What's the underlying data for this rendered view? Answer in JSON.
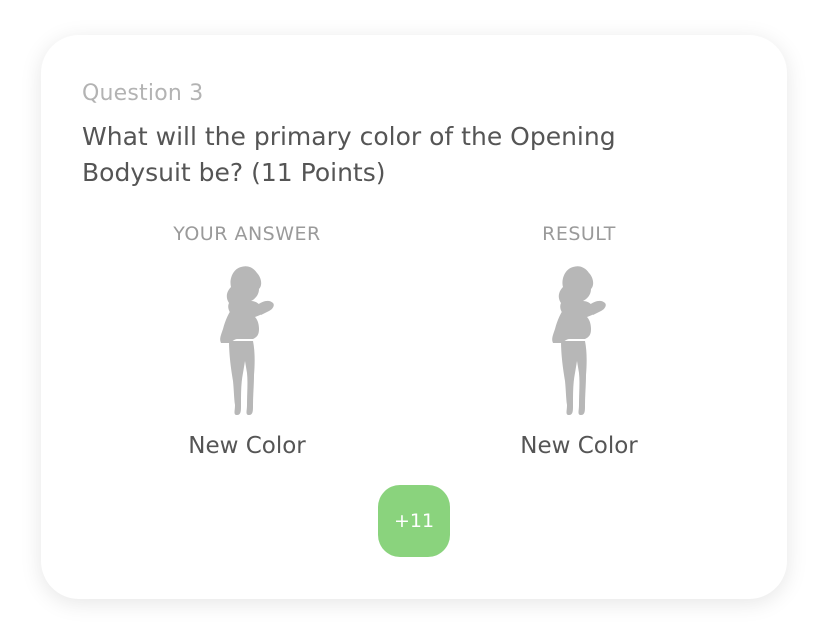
{
  "question": {
    "label": "Question 3",
    "text": "What will the primary color of the Opening Bodysuit be? (11 Points)"
  },
  "your_answer": {
    "heading": "YOUR ANSWER",
    "value": "New Color",
    "image": "silhouette-icon"
  },
  "result": {
    "heading": "RESULT",
    "value": "New Color",
    "image": "silhouette-icon"
  },
  "score": {
    "label": "+11"
  },
  "colors": {
    "badge": "#8ad37d",
    "silhouette": "#b7b7b7",
    "text": "#555555",
    "muted": "#b3b3b3"
  }
}
